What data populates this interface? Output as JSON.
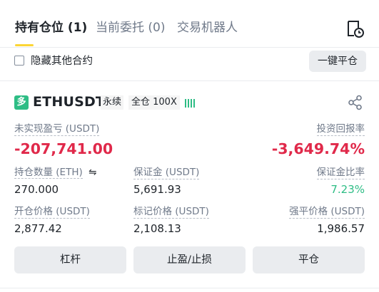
{
  "tabs": [
    {
      "label": "持有仓位 (1)"
    },
    {
      "label": "当前委托 (0)"
    },
    {
      "label": "交易机器人"
    }
  ],
  "hide_other_contracts": {
    "label": "隐藏其他合约",
    "checked": false
  },
  "close_all_button": "一键平仓",
  "position": {
    "side_badge": "多",
    "symbol": "ETHUSDT",
    "contract_type": "永续",
    "margin_mode": "全仓 100X",
    "unrealized_pnl": {
      "label": "未实现盈亏 (USDT)",
      "value": "-207,741.00"
    },
    "roi": {
      "label": "投资回报率",
      "value": "-3,649.74%"
    },
    "size": {
      "label": "持仓数量 (ETH)",
      "swap_icon": "⇋",
      "value": "270.000"
    },
    "margin": {
      "label": "保证金 (USDT)",
      "value": "5,691.93"
    },
    "margin_ratio": {
      "label": "保证金比率",
      "value": "7.23%"
    },
    "entry_price": {
      "label": "开仓价格 (USDT)",
      "value": "2,877.42"
    },
    "mark_price": {
      "label": "标记价格 (USDT)",
      "value": "2,108.13"
    },
    "liq_price": {
      "label": "强平价格 (USDT)",
      "value": "1,986.57"
    }
  },
  "buttons": {
    "leverage": "杠杆",
    "tp_sl": "止盈/止损",
    "close": "平仓"
  },
  "colors": {
    "long_green": "#2ebd85",
    "loss_red": "#e0294a",
    "accent_yellow": "#fcd535"
  },
  "icons": {
    "history": "history-icon",
    "share": "share-icon",
    "leverage_level": "leverage-bars-icon"
  }
}
